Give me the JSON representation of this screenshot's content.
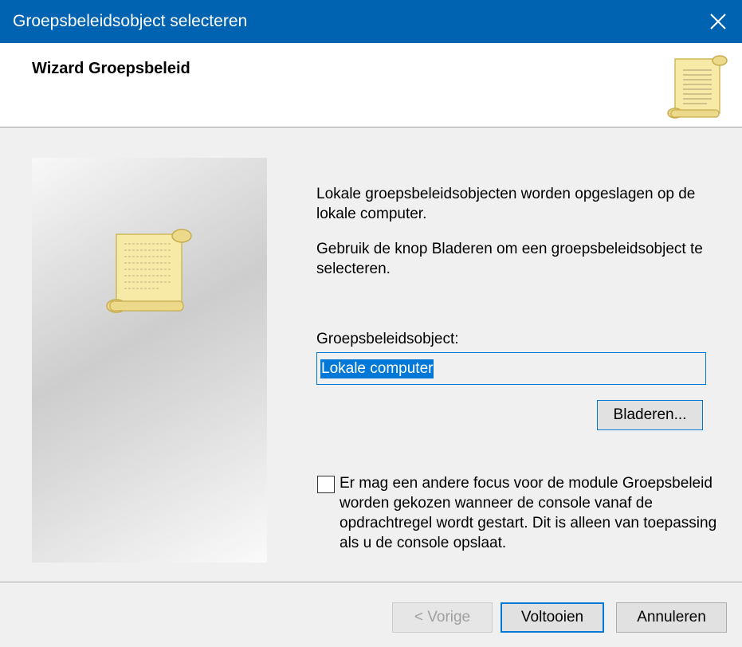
{
  "window": {
    "title": "Groepsbeleidsobject selecteren",
    "close_icon": "close-icon",
    "titlebar_color": "#0063b1"
  },
  "header": {
    "title": "Wizard Groepsbeleid",
    "icon": "scroll-icon"
  },
  "side_panel": {
    "icon": "scroll-icon"
  },
  "main": {
    "intro_1": "Lokale groepsbeleidsobjecten worden opgeslagen op de lokale computer.",
    "intro_2": "Gebruik de knop Bladeren om een groepsbeleidsobject te selecteren.",
    "gpo_label": "Groepsbeleidsobject:",
    "gpo_value": "Lokale computer",
    "browse_label": "Bladeren...",
    "checkbox_checked": false,
    "checkbox_label": "Er mag een andere focus voor de module Groepsbeleid worden gekozen wanneer de console vanaf de opdrachtregel wordt gestart. Dit is alleen van toepassing als u de console opslaat."
  },
  "footer": {
    "back_label": "< Vorige",
    "finish_label": "Voltooien",
    "cancel_label": "Annuleren"
  },
  "colors": {
    "accent": "#0078d7",
    "scroll_paper": "#f6eaa6",
    "scroll_edge": "#d1b85c"
  }
}
